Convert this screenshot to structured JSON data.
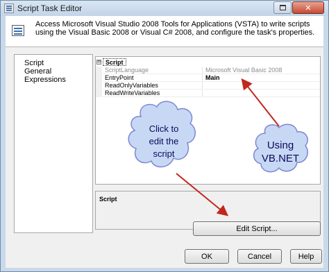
{
  "window": {
    "title": "Script Task Editor",
    "close_glyph": "✕"
  },
  "header": {
    "description": "Access Microsoft Visual Studio 2008 Tools for Applications (VSTA) to write scripts using the Visual Basic 2008 or Visual C# 2008, and configure the task's properties."
  },
  "nav": {
    "items": [
      {
        "label": "Script"
      },
      {
        "label": "General"
      },
      {
        "label": "Expressions"
      }
    ]
  },
  "grid": {
    "category": {
      "label": "Script",
      "expander": "⊟"
    },
    "rows": [
      {
        "name": "ScriptLanguage",
        "value": "Microsoft Visual Basic 2008"
      },
      {
        "name": "EntryPoint",
        "value": "Main"
      },
      {
        "name": "ReadOnlyVariables",
        "value": ""
      },
      {
        "name": "ReadWriteVariables",
        "value": ""
      }
    ]
  },
  "description_panel": {
    "title": "Script"
  },
  "buttons": {
    "edit_script": "Edit Script...",
    "ok": "OK",
    "cancel": "Cancel",
    "help": "Help"
  },
  "annotations": {
    "cloud_left": {
      "line1": "Click to",
      "line2": "edit the",
      "line3": "script"
    },
    "cloud_right": {
      "line1": "Using",
      "line2": "VB.NET"
    }
  },
  "colors": {
    "arrow": "#c0281e",
    "cloud_fill": "#c7d8f5",
    "cloud_stroke": "#7f86d0",
    "cloud_text": "#0a0a5a"
  }
}
